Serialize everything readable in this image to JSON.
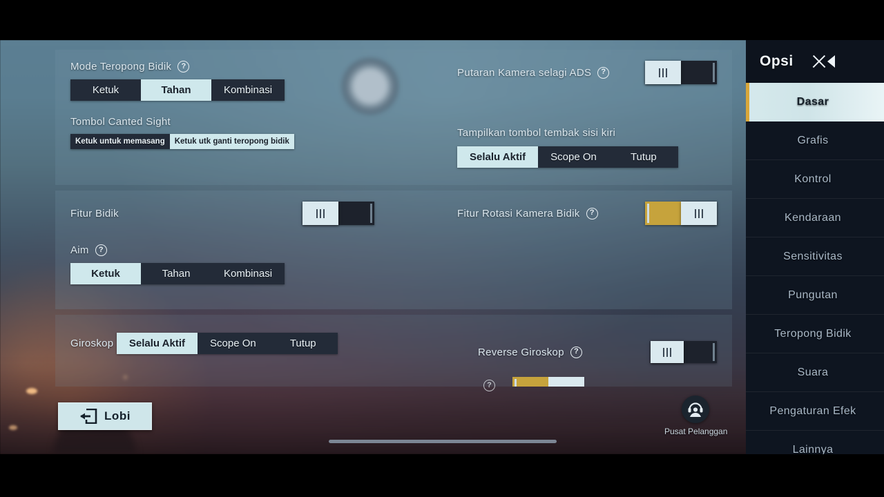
{
  "window": {
    "sidebar_title": "Opsi"
  },
  "sidebar": {
    "items": [
      {
        "label": "Dasar",
        "active": true
      },
      {
        "label": "Grafis",
        "active": false
      },
      {
        "label": "Kontrol",
        "active": false
      },
      {
        "label": "Kendaraan",
        "active": false
      },
      {
        "label": "Sensitivitas",
        "active": false
      },
      {
        "label": "Pungutan",
        "active": false
      },
      {
        "label": "Teropong Bidik",
        "active": false
      },
      {
        "label": "Suara",
        "active": false
      },
      {
        "label": "Pengaturan Efek",
        "active": false
      },
      {
        "label": "Lainnya",
        "active": false
      }
    ]
  },
  "settings": {
    "scope_mode": {
      "label": "Mode Teropong Bidik",
      "options": [
        "Ketuk",
        "Tahan",
        "Kombinasi"
      ],
      "selected": "Tahan"
    },
    "canted_sight": {
      "label": "Tombol Canted Sight",
      "options": [
        "Ketuk untuk memasang",
        "Ketuk utk ganti teropong bidik"
      ],
      "selected": "Ketuk utk ganti teropong bidik"
    },
    "camera_rotation_ads": {
      "label": "Putaran Kamera selagi ADS",
      "state": "off"
    },
    "left_fire_button": {
      "label": "Tampilkan tombol tembak sisi kiri",
      "options": [
        "Selalu Aktif",
        "Scope On",
        "Tutup"
      ],
      "selected": "Selalu Aktif"
    },
    "aim_feature": {
      "label": "Fitur Bidik",
      "state": "off"
    },
    "aim_camera_rotation": {
      "label": "Fitur Rotasi Kamera Bidik",
      "state": "on"
    },
    "aim": {
      "label": "Aim",
      "options": [
        "Ketuk",
        "Tahan",
        "Kombinasi"
      ],
      "selected": "Ketuk"
    },
    "gyroscope": {
      "label": "Giroskop",
      "options": [
        "Selalu Aktif",
        "Scope On",
        "Tutup"
      ],
      "selected": "Selalu Aktif"
    },
    "reverse_gyroscope": {
      "label": "Reverse Giroskop",
      "state": "off"
    }
  },
  "footer": {
    "lobby_button": "Lobi",
    "customer_service": "Pusat Pelanggan"
  },
  "icons": {
    "help": "?",
    "exit": "exit-arrow-icon",
    "close": "close-icon",
    "collapse": "collapse-left-arrow-icon",
    "headset": "customer-support-icon"
  },
  "colors": {
    "accent_gold": "#d9a73a",
    "selected_segment": "#cfe8ec",
    "segment_track": "#232b38",
    "sidebar_bg": "#0e1520",
    "toggle_on": "#c6a33c"
  }
}
